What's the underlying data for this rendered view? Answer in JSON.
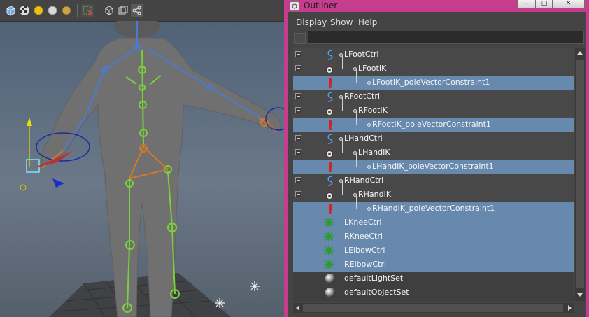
{
  "outliner": {
    "title": "Outliner",
    "menu": [
      "Display",
      "Show",
      "Help"
    ],
    "filter_value": "",
    "items": [
      {
        "label": "LFootCtrl",
        "icon": "nurbs-curve-icon",
        "selected": false
      },
      {
        "label": "LFootIK",
        "icon": "ik-handle-icon",
        "selected": false
      },
      {
        "label": "LFootIK_poleVectorConstraint1",
        "icon": "constraint-icon",
        "selected": true
      },
      {
        "label": "RFootCtrl",
        "icon": "nurbs-curve-icon",
        "selected": false
      },
      {
        "label": "RFootIK",
        "icon": "ik-handle-icon",
        "selected": false
      },
      {
        "label": "RFootIK_poleVectorConstraint1",
        "icon": "constraint-icon",
        "selected": true
      },
      {
        "label": "LHandCtrl",
        "icon": "nurbs-curve-icon",
        "selected": false
      },
      {
        "label": "LHandIK",
        "icon": "ik-handle-icon",
        "selected": false
      },
      {
        "label": "LHandIK_poleVectorConstraint1",
        "icon": "constraint-icon",
        "selected": true
      },
      {
        "label": "RHandCtrl",
        "icon": "nurbs-curve-icon",
        "selected": false
      },
      {
        "label": "RHandIK",
        "icon": "ik-handle-icon",
        "selected": false
      },
      {
        "label": "RHandIK_poleVectorConstraint1",
        "icon": "constraint-icon",
        "selected": true
      },
      {
        "label": "LKneeCtrl",
        "icon": "locator-icon",
        "selected": true
      },
      {
        "label": "RKneeCtrl",
        "icon": "locator-icon",
        "selected": true
      },
      {
        "label": "LElbowCtrl",
        "icon": "locator-icon",
        "selected": true
      },
      {
        "label": "RElbowCtrl",
        "icon": "locator-icon",
        "selected": true
      },
      {
        "label": "defaultLightSet",
        "icon": "set-icon",
        "selected": false
      },
      {
        "label": "defaultObjectSet",
        "icon": "set-icon",
        "selected": false
      }
    ]
  },
  "viewport": {
    "toolbar_icons": [
      "wireframe-cube-icon",
      "checker-texture-icon",
      "default-light-icon",
      "all-lights-icon",
      "shadow-icon",
      "select-camera-icon",
      "isolate-select-icon",
      "xray-icon",
      "xray-joints-icon"
    ]
  },
  "colors": {
    "title_bar": "#c63d8d",
    "selection": "#6789ad",
    "row_unselected": "#484848",
    "panel_bg": "#444444",
    "skeleton_blue": "#4a7bd4",
    "skeleton_green": "#7ad23a",
    "skeleton_orange": "#d07a2a"
  }
}
